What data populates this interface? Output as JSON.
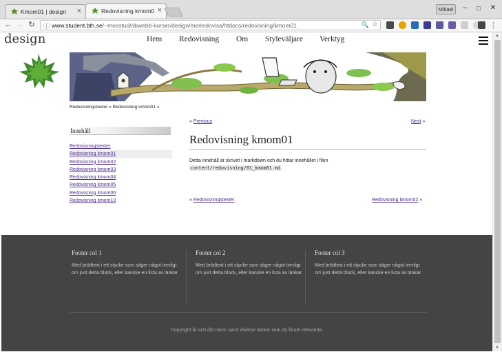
{
  "browser": {
    "tabs": [
      {
        "title": "Kmom01 | design",
        "active": false
      },
      {
        "title": "Redovisning kmom0",
        "active": true
      }
    ],
    "profile_label": "Mikael",
    "url_host": "www.student.bth.se",
    "url_path": "/~mosstud/dbwebb-kurser/design/me/redovisa/htdocs/redovisning/kmom01",
    "tab_close_glyph": "×",
    "nav": {
      "back": "←",
      "forward": "→",
      "reload": "↻"
    },
    "window": {
      "minimize": "–",
      "maximize": "□",
      "close": "✕"
    },
    "menu_glyph": "⋮",
    "zoom_glyph": "🔍",
    "star_glyph": "☆",
    "lock_glyph": "ⓘ"
  },
  "site": {
    "title": "design",
    "nav": [
      {
        "label": "Hem"
      },
      {
        "label": "Redovisning"
      },
      {
        "label": "Om"
      },
      {
        "label": "Styleväljare"
      },
      {
        "label": "Verktyg"
      }
    ]
  },
  "breadcrumb": "Redovisningstexter » Redovisning kmom01 »",
  "sidebar": {
    "title": "Innehåll",
    "items": [
      {
        "label": "Redovisningstexter"
      },
      {
        "label": "Redovisning kmom01"
      },
      {
        "label": "Redovisning kmom02"
      },
      {
        "label": "Redovisning kmom03"
      },
      {
        "label": "Redovisning kmom04"
      },
      {
        "label": "Redovisning kmom05"
      },
      {
        "label": "Redovisning kmom06"
      },
      {
        "label": "Redovisning kmom10"
      }
    ]
  },
  "pager_top": {
    "prev_prefix": "«",
    "prev_label": "Previous",
    "next_label": "Next",
    "next_suffix": "»"
  },
  "article": {
    "heading": "Redovisning kmom01",
    "text_1": "Detta innehåll är skrivet i markdown och du hittar innehållet i filen",
    "code": "content/redovisning/01_kmom01.md",
    "text_2": "."
  },
  "pager_bottom": {
    "prev_prefix": "«",
    "prev_label": "Redovisningstexter",
    "next_label": "Redovisning kmom02",
    "next_suffix": "»"
  },
  "footer": {
    "cols": [
      {
        "heading": "Footer col 1",
        "text": "Med brödtext i ett stycke som säger något trevligt om just detta block, eller kanske en lista av länkar."
      },
      {
        "heading": "Footer col 2",
        "text": "Med brödtext i ett stycke som säger något trevligt om just detta block, eller kanske en lista av länkar."
      },
      {
        "heading": "Footer col 3",
        "text": "Med brödtext i ett stycke som säger något trevligt om just detta block, eller kanske en lista av länkar."
      }
    ],
    "copyright": "Copyright år och ditt namn samt diverse länkar som du finner relevanta."
  },
  "colors": {
    "link": "#4b2a8c",
    "footer_bg": "#444444",
    "leaf_green": "#3f8a2a"
  },
  "icons": [
    "leaf-favicon",
    "close-icon",
    "back-arrow-icon",
    "forward-arrow-icon",
    "reload-icon",
    "info-icon",
    "zoom-icon",
    "star-icon",
    "hamburger-menu-icon",
    "maple-leaf-logo",
    "kebab-menu-icon"
  ]
}
